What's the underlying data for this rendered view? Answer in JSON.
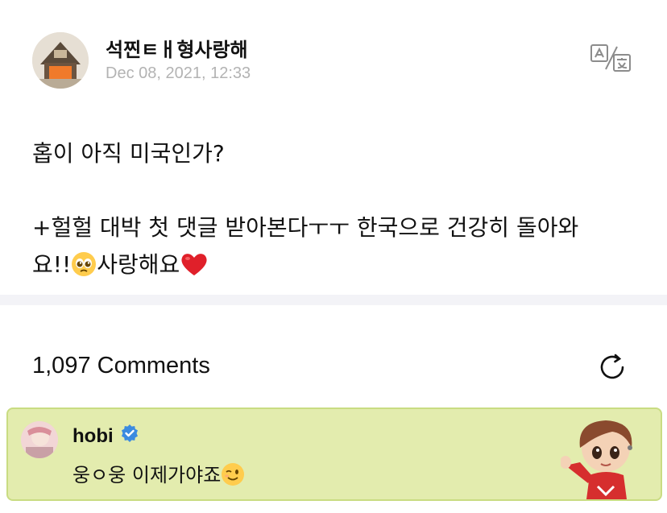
{
  "post": {
    "author": "석찐ㅌㅐ형사랑해",
    "date": "Dec 08, 2021, 12:33",
    "body_line1": "홉이 아직 미국인가?",
    "body_line2": "+헐헐 대박 첫 댓글 받아본다ㅜㅜ 한국으로 건강히 돌아와",
    "body_line3_start": "요!!",
    "body_line3_end": "사랑해요",
    "emoji_pleading": "pleading-face-emoji",
    "emoji_heart": "red-heart-emoji",
    "translate_icon": "translate-icon"
  },
  "comments": {
    "count_label": "1,097 Comments",
    "refresh_icon": "refresh-icon",
    "highlight": {
      "author": "hobi",
      "verified_icon": "verified-badge-icon",
      "text": "웅ㅇ웅 이제가야죠",
      "emoji": "winking-face-emoji",
      "sticker": "character-sticker"
    }
  },
  "colors": {
    "highlight_bg": "#e3ecae",
    "highlight_border": "#c9dc82",
    "date_text": "#b3b3b3",
    "divider": "#f3f3f7",
    "verified_blue": "#3b8be0",
    "heart_red": "#e0202a"
  }
}
